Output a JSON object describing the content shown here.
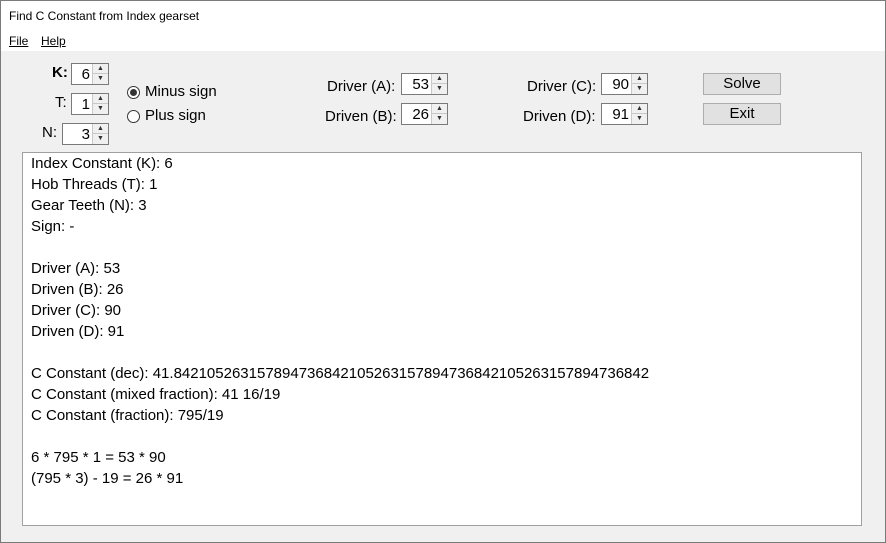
{
  "window": {
    "title": "Find C Constant from Index gearset"
  },
  "menu": {
    "file": "File",
    "help": "Help"
  },
  "inputs": {
    "k_label": "K:",
    "k_value": "6",
    "t_label": "T:",
    "t_value": "1",
    "n_label": "N:",
    "n_value": "3",
    "driver_a_label": "Driver (A):",
    "driver_a_value": "53",
    "driven_b_label": "Driven (B):",
    "driven_b_value": "26",
    "driver_c_label": "Driver (C):",
    "driver_c_value": "90",
    "driven_d_label": "Driven (D):",
    "driven_d_value": "91"
  },
  "sign_options": {
    "minus": "Minus sign",
    "plus": "Plus sign",
    "selected": "minus"
  },
  "buttons": {
    "solve": "Solve",
    "exit": "Exit"
  },
  "output": {
    "lines": [
      "Index Constant (K): 6",
      "Hob Threads (T): 1",
      "Gear Teeth (N): 3",
      "Sign: -",
      "",
      "Driver (A): 53",
      "Driven (B): 26",
      "Driver (C): 90",
      "Driven (D): 91",
      "",
      "C Constant (dec): 41.842105263157894736842105263157894736842105263157894736842",
      "C Constant (mixed fraction): 41 16/19",
      "C Constant (fraction): 795/19",
      "",
      "6 * 795 * 1 = 53 * 90",
      "(795 * 3) - 19 = 26 * 91"
    ]
  }
}
